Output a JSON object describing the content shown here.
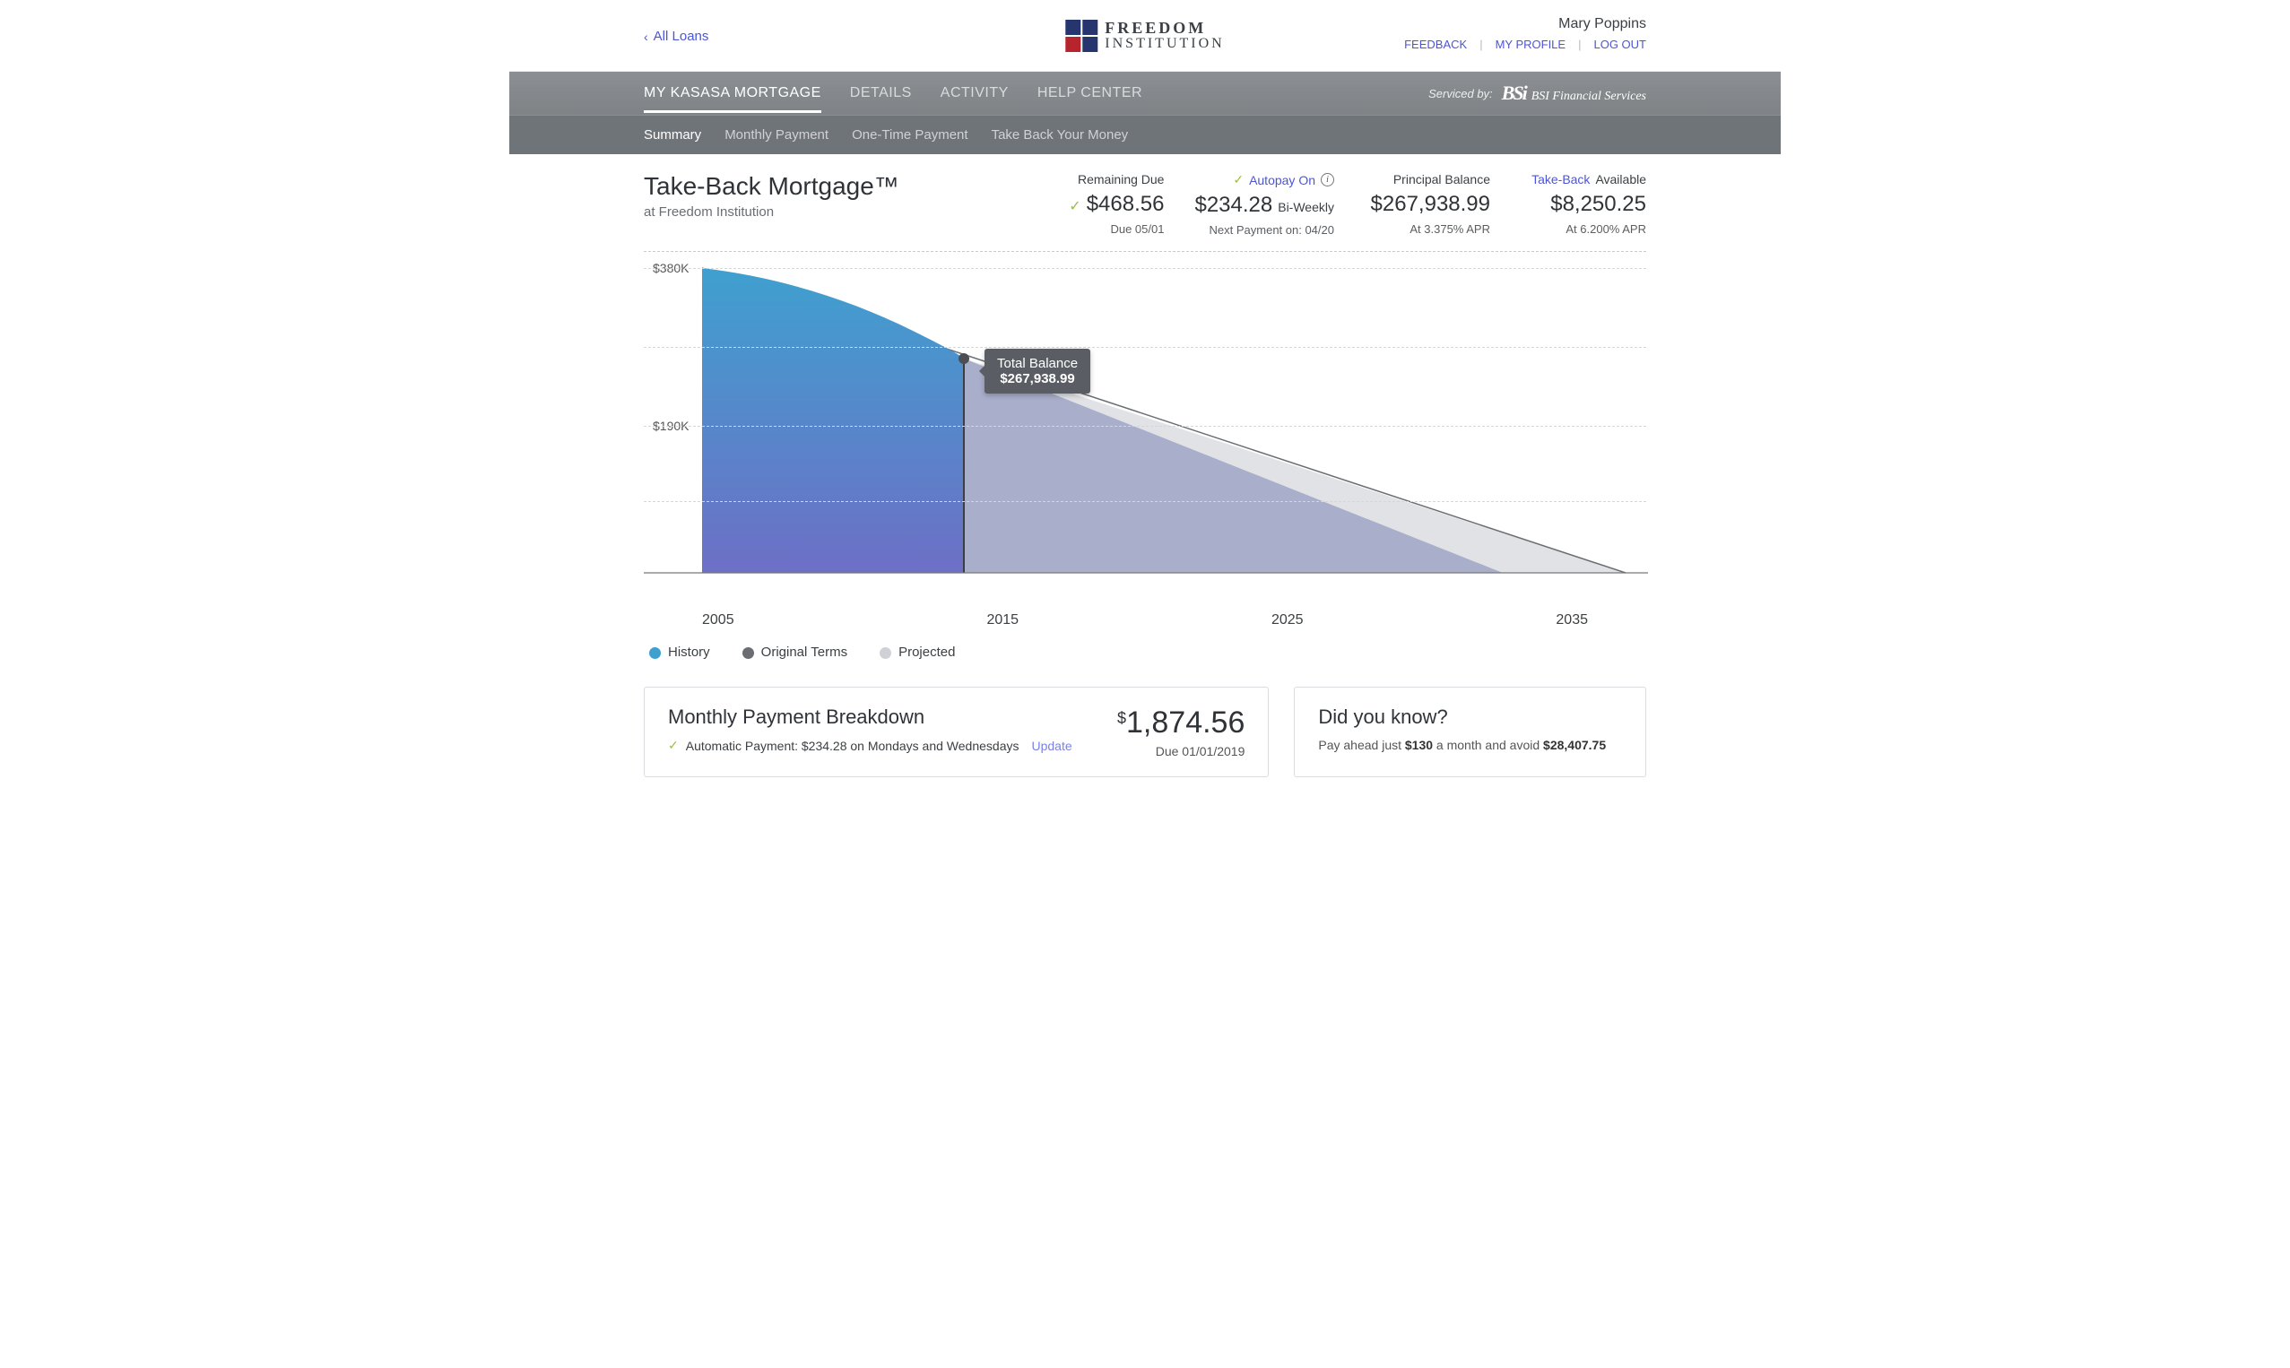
{
  "colors": {
    "link": "#4b55d8",
    "history_fill": "#4a8fbf",
    "history_fill2": "#6d6fc6",
    "original_line": "#6a6e72",
    "projected_fill": "#b6b9cf",
    "projected_light": "#dedfe3",
    "check": "#9bbf3e"
  },
  "topbar": {
    "back_label": "All Loans",
    "brand_line1": "FREEDOM",
    "brand_line2": "INSTITUTION",
    "user_name": "Mary Poppins",
    "links": {
      "feedback": "FEEDBACK",
      "profile": "MY PROFILE",
      "logout": "LOG OUT"
    }
  },
  "mainnav": {
    "tabs": [
      "MY KASASA MORTGAGE",
      "DETAILS",
      "ACTIVITY",
      "HELP CENTER"
    ],
    "active_index": 0,
    "serviced_label": "Serviced by:",
    "servicer_name": "BSI Financial Services"
  },
  "subnav": {
    "tabs": [
      "Summary",
      "Monthly Payment",
      "One-Time Payment",
      "Take Back Your Money"
    ],
    "active_index": 0
  },
  "summary": {
    "title": "Take-Back Mortgage™",
    "subtitle": "at Freedom Institution",
    "stats": {
      "remaining": {
        "label": "Remaining Due",
        "amount": "$468.56",
        "note": "Due 05/01",
        "has_check": true
      },
      "autopay": {
        "label_prefix_check": true,
        "label_link": "Autopay On",
        "has_info": true,
        "amount": "$234.28",
        "amount_suffix": "Bi-Weekly",
        "note": "Next Payment on: 04/20"
      },
      "principal": {
        "label": "Principal Balance",
        "amount": "$267,938.99",
        "note": "At 3.375% APR"
      },
      "takeback": {
        "label_link": "Take-Back",
        "label_rest": " Available",
        "amount": "$8,250.25",
        "note": "At 6.200% APR"
      }
    }
  },
  "chart_data": {
    "type": "area",
    "title": "",
    "xlabel": "",
    "ylabel": "",
    "x_ticks": [
      "2005",
      "2015",
      "2025",
      "2035"
    ],
    "y_ticks": [
      "$380K",
      "$190K"
    ],
    "ylim": [
      0,
      380000
    ],
    "xlim": [
      2005,
      2035
    ],
    "series": [
      {
        "name": "Original Terms",
        "role": "line",
        "values": [
          [
            2005,
            380000
          ],
          [
            2035,
            0
          ]
        ]
      },
      {
        "name": "Projected (upper band)",
        "role": "area",
        "values": [
          [
            2013.5,
            267939
          ],
          [
            2035,
            0
          ]
        ]
      },
      {
        "name": "Projected (ahead-of-schedule)",
        "role": "area",
        "values": [
          [
            2013.5,
            267939
          ],
          [
            2031,
            0
          ]
        ]
      },
      {
        "name": "History",
        "role": "area",
        "values": [
          [
            2005,
            380000
          ],
          [
            2007,
            370000
          ],
          [
            2009,
            350000
          ],
          [
            2011,
            320000
          ],
          [
            2013.5,
            267939
          ]
        ]
      }
    ],
    "legend": [
      "History",
      "Original Terms",
      "Projected"
    ],
    "legend_colors": [
      "#3fa0cf",
      "#6a6e72",
      "#cfd1d6"
    ],
    "marker": {
      "x": 2013.5,
      "y": 267939,
      "tooltip_title": "Total Balance",
      "tooltip_value": "$267,938.99"
    }
  },
  "breakdown": {
    "heading": "Monthly Payment Breakdown",
    "amount_dollar": "$",
    "amount": "1,874.56",
    "due": "Due 01/01/2019",
    "auto_text": "Automatic Payment: $234.28 on Mondays and Wednesdays",
    "update_label": "Update"
  },
  "tip": {
    "heading": "Did you know?",
    "text_pre": "Pay ahead just ",
    "monthly": "$130",
    "text_mid": " a month and avoid ",
    "savings": "$28,407.75"
  }
}
